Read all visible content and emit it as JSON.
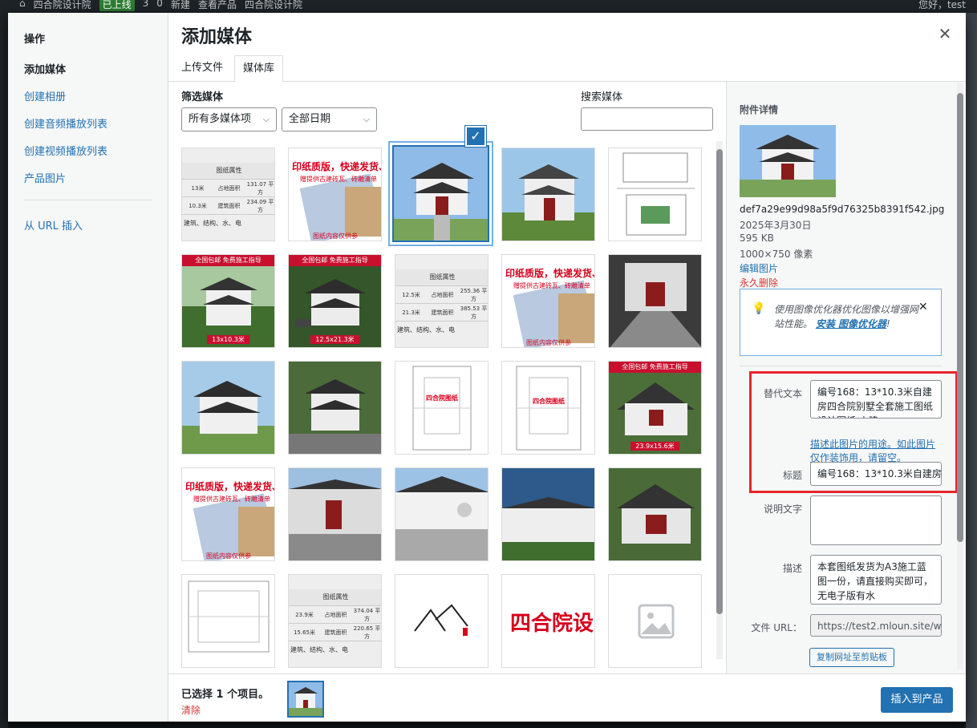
{
  "adminbar": {
    "site": "四合院设计院",
    "status": "已上线",
    "updates": "3",
    "comments": "0",
    "new": "新建",
    "view": "查看产品",
    "site2": "四合院设计院",
    "howdy": "您好，test"
  },
  "menu": {
    "heading": "操作",
    "items": [
      "添加媒体",
      "创建相册",
      "创建音频播放列表",
      "创建视频播放列表",
      "产品图片",
      "从 URL 插入"
    ]
  },
  "title": "添加媒体",
  "tabs": [
    "上传文件",
    "媒体库"
  ],
  "filter": {
    "label": "筛选媒体",
    "type_value": "所有多媒体项",
    "date_value": "全部日期",
    "search_label": "搜索媒体"
  },
  "thumbs": {
    "table1": {
      "title": "图纸属性",
      "r1": [
        "13米",
        "占地面积",
        "131.07 平方"
      ],
      "r2": [
        "10.3米",
        "建筑面积",
        "234.09 平方"
      ],
      "foot": "建筑、结构、水、电"
    },
    "table2": {
      "title": "图纸属性",
      "r1": [
        "12.5米",
        "占地面积",
        "255.36 平方"
      ],
      "r2": [
        "21.3米",
        "建筑面积",
        "385.53 平方"
      ],
      "foot": "建筑、结构、水、电"
    },
    "table3": {
      "title": "图纸属性",
      "r1": [
        "23.9米",
        "占地面积",
        "374.04 平方"
      ],
      "r2": [
        "15.65米",
        "建筑面积",
        "220.65 平方"
      ],
      "foot": "建筑、结构、水、电"
    },
    "promo_big": "印纸质版，快递发货、无",
    "promo_sub": "赠提供古建砖瓦、砖雕清单",
    "promo_foot": "图纸内容仅供参",
    "banner": "全国包邮  免费施工指导",
    "cap1": "13x10.3米",
    "cap2": "12.5x21.3米",
    "cap3": "23.9x15.6米",
    "plan_text": "四合院图纸",
    "logo_text": "四合院设"
  },
  "sidebar": {
    "heading": "附件详情",
    "filename": "def7a29e99d98a5f9d76325b8391f542.jpg",
    "date": "2025年3月30日",
    "size": "595 KB",
    "dims": "1000×750 像素",
    "edit": "编辑图片",
    "delete": "永久删除",
    "notice_text": "使用图像优化器优化图像以增强网站性能。",
    "notice_link": "安装 图像优化器",
    "notice_end": "!",
    "alt_label": "替代文本",
    "alt_value": "编号168：13*10.3米自建房四合院别墅全套施工图纸设计图纸 小建",
    "alt_note_link": "描述此图片的用途",
    "alt_note": "。如此图片仅作装饰用，请留空。",
    "title_label": "标题",
    "title_value": "编号168：13*10.3米自建房",
    "caption_label": "说明文字",
    "caption_value": "",
    "desc_label": "描述",
    "desc_value": "本套图纸发货为A3施工蓝图一份，请直接购买即可，无电子版有水",
    "url_label": "文件 URL：",
    "url_value": "https://test2.mloun.site/w",
    "copy_btn": "复制网址至剪贴板"
  },
  "toolbar": {
    "selected": "已选择 1 个项目。",
    "clear": "清除",
    "insert": "插入到产品"
  }
}
